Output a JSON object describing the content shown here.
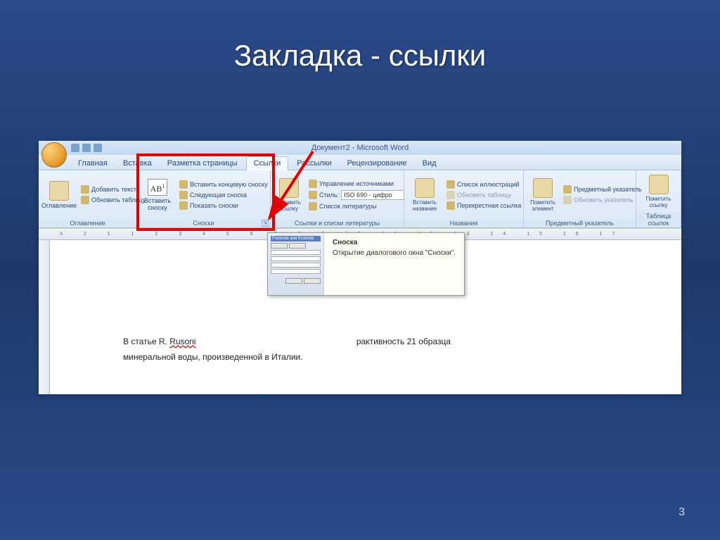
{
  "slide": {
    "title": "Закладка - ссылки",
    "number": "3"
  },
  "app_title": "Документ2 - Microsoft Word",
  "tabs": {
    "home": "Главная",
    "insert": "Вставка",
    "layout": "Разметка страницы",
    "references": "Ссылки",
    "mailings": "Рассылки",
    "review": "Рецензирование",
    "view": "Вид"
  },
  "ribbon": {
    "toc": {
      "main": "Оглавление",
      "add_text": "Добавить текст",
      "update": "Обновить таблицу",
      "label": "Оглавление"
    },
    "footnotes": {
      "insert": "Вставить сноску",
      "endnote": "Вставить концевую сноску",
      "next": "Следующая сноска",
      "show": "Показать сноски",
      "label": "Сноски"
    },
    "citations": {
      "insert": "Вставить ссылку",
      "manage": "Управление источниками",
      "style_label": "Стиль:",
      "style_value": "ISO 690 - цифро",
      "biblio": "Список литературы",
      "label": "Ссылки и списки литературы"
    },
    "captions": {
      "insert": "Вставить название",
      "figures": "Список иллюстраций",
      "update": "Обновить таблицу",
      "cross": "Перекрестная ссылка",
      "label": "Названия"
    },
    "index": {
      "mark": "Пометить элемент",
      "insert": "Предметный указатель",
      "update": "Обновить указатель",
      "label": "Предметный указатель"
    },
    "toa": {
      "mark": "Пометить ссылку",
      "label": "Таблица ссылок"
    }
  },
  "tooltip": {
    "title": "Сноска",
    "body": "Открытие диалогового окна \"Сноски\".",
    "dlg_title": "Footnote and Endnote"
  },
  "document": {
    "line1_a": "В статье R. ",
    "line1_b": "Rusoni",
    "line1_c": "рактивность 21 образца",
    "line2": "минеральной воды, произведенной в Италии."
  },
  "ruler": "3 2 1 1 2 3 4 5 6 7 8 9 10 11 12 13 14 15 16 17"
}
